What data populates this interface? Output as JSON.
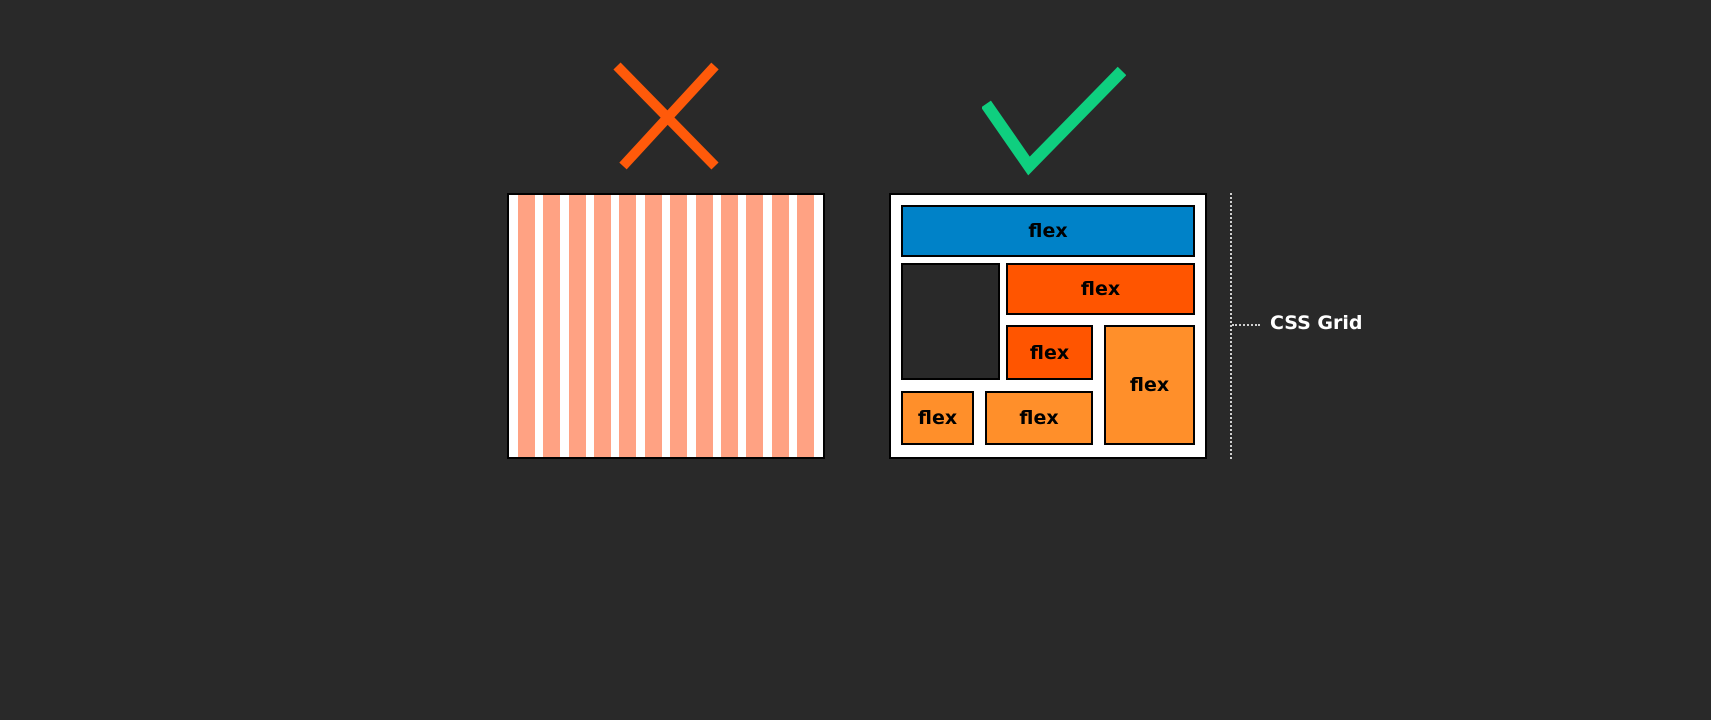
{
  "colors": {
    "background": "#292929",
    "wrong_icon": "#ff5a0a",
    "right_icon": "#0fcf7f",
    "column_fill": "#ffa283",
    "blue": "#0082c8",
    "red_orange": "#ff5500",
    "orange": "#ff8f2a",
    "dark": "#292929",
    "panel_bg": "#ffffff",
    "label": "#ffffff"
  },
  "icons": {
    "wrong": "x-mark-icon",
    "right": "check-mark-icon"
  },
  "left_panel": {
    "column_count": 12
  },
  "right_panel": {
    "blocks": {
      "header": "flex",
      "side_empty": "",
      "top_right": "flex",
      "middle_small": "flex",
      "tall_right": "flex",
      "bottom_left": "flex",
      "bottom_middle": "flex"
    }
  },
  "annotation": {
    "label": "CSS Grid"
  }
}
